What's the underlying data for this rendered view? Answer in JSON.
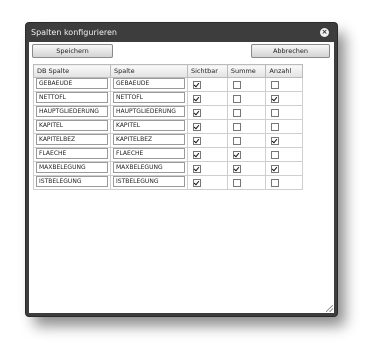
{
  "dialog": {
    "title": "Spalten konfigurieren",
    "close_icon": "close-icon"
  },
  "toolbar": {
    "save_label": "Speichern",
    "cancel_label": "Abbrechen"
  },
  "table": {
    "headers": [
      "DB Spalte",
      "Spalte",
      "Sichtbar",
      "Summe",
      "Anzahl"
    ],
    "rows": [
      {
        "db_spalte": "GEBAEUDE",
        "spalte": "GEBAEUDE",
        "sichtbar": true,
        "summe": false,
        "anzahl": false
      },
      {
        "db_spalte": "NETTOFL",
        "spalte": "NETTOFL",
        "sichtbar": true,
        "summe": false,
        "anzahl": true
      },
      {
        "db_spalte": "HAUPTGLIEDERUNG",
        "spalte": "HAUPTGLIEDERUNG",
        "sichtbar": true,
        "summe": false,
        "anzahl": false
      },
      {
        "db_spalte": "KAPITEL",
        "spalte": "KAPITEL",
        "sichtbar": true,
        "summe": false,
        "anzahl": false
      },
      {
        "db_spalte": "KAPITELBEZ",
        "spalte": "KAPITELBEZ",
        "sichtbar": true,
        "summe": false,
        "anzahl": true
      },
      {
        "db_spalte": "FLAECHE",
        "spalte": "FLAECHE",
        "sichtbar": true,
        "summe": true,
        "anzahl": false
      },
      {
        "db_spalte": "MAXBELEGUNG",
        "spalte": "MAXBELEGUNG",
        "sichtbar": true,
        "summe": true,
        "anzahl": true
      },
      {
        "db_spalte": "ISTBELEGUNG",
        "spalte": "ISTBELEGUNG",
        "sichtbar": true,
        "summe": false,
        "anzahl": false
      }
    ]
  }
}
